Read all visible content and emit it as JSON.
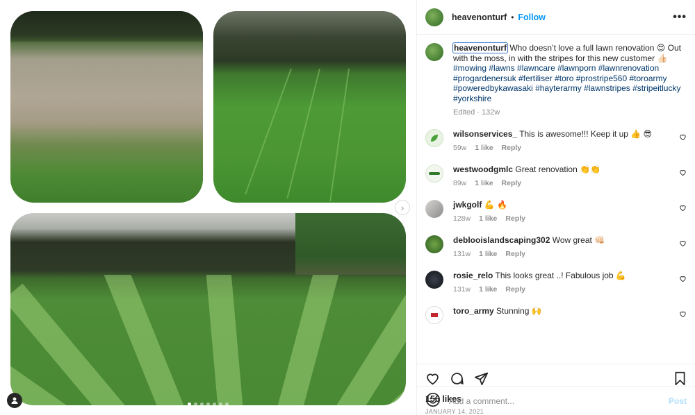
{
  "post": {
    "author": "heavenonturf",
    "separator": "•",
    "follow_label": "Follow",
    "more_label": "•••",
    "caption_user": "heavenonturf",
    "caption_text": " Who doesn’t love a full lawn renovation 😍 Out with the moss, in with the stripes for this new customer 👍🏻 ",
    "caption_tags": "#mowing #lawns #lawncare #lawnporn #lawnrenovation #progardenersuk #fertiliser #toro #prostripe560 #toroarmy #poweredbykawasaki #hayterarmy #lawnstripes #stripeitlucky #yorkshire",
    "caption_meta": "Edited · 132w",
    "likes": "156 likes",
    "date": "JANUARY 14, 2021",
    "add_comment_placeholder": "Add a comment...",
    "post_label": "Post"
  },
  "comments": [
    {
      "user": "wilsonservices_",
      "text": "This is awesome!!! Keep it up 👍 😎",
      "age": "59w",
      "likes": "1 like",
      "reply": "Reply"
    },
    {
      "user": "westwoodgmlc",
      "text": "Great renovation 👏👏",
      "age": "89w",
      "likes": "1 like",
      "reply": "Reply"
    },
    {
      "user": "jwkgolf",
      "text": "💪 🔥",
      "age": "128w",
      "likes": "1 like",
      "reply": "Reply"
    },
    {
      "user": "deblooislandscaping302",
      "text": "Wow great 👊🏻",
      "age": "131w",
      "likes": "1 like",
      "reply": "Reply"
    },
    {
      "user": "rosie_relo",
      "text": "This looks great ..! Fabulous job 💪",
      "age": "131w",
      "likes": "1 like",
      "reply": "Reply"
    },
    {
      "user": "toro_army",
      "text": "Stunning 🙌",
      "age": "",
      "likes": "",
      "reply": ""
    }
  ],
  "icons": {
    "like": "heart-icon",
    "comment": "comment-icon",
    "share": "paper-plane-icon",
    "save": "bookmark-icon",
    "emoji": "emoji-icon",
    "next": "chevron-right-icon",
    "tag": "user-tag-icon"
  },
  "colors": {
    "link": "#0095f6",
    "hashtag": "#00376b",
    "muted": "#8e8e8e",
    "post_disabled": "#b2dffc"
  }
}
